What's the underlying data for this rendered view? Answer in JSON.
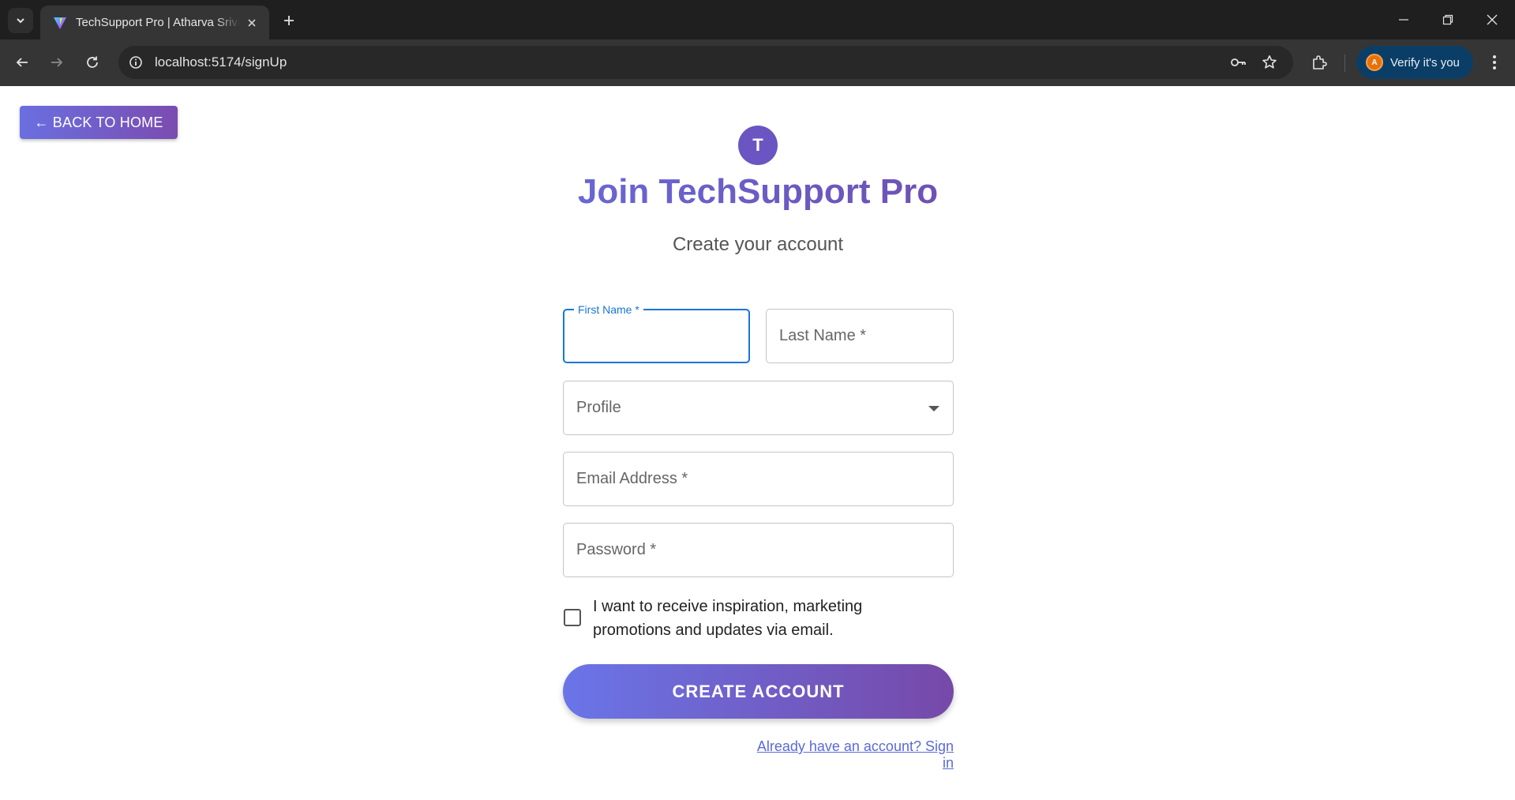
{
  "browser": {
    "tab_title": "TechSupport Pro | Atharva Srivastava",
    "url": "localhost:5174/signUp",
    "profile_initial": "A",
    "verify_label": "Verify it's you"
  },
  "page": {
    "back_button": "← BACK TO HOME",
    "logo_letter": "T",
    "title": "Join TechSupport Pro",
    "subtitle": "Create your account",
    "fields": {
      "first_name_label": "First Name *",
      "first_name_value": "",
      "last_name_label": "Last Name *",
      "profile_label": "Profile",
      "email_label": "Email Address *",
      "password_label": "Password *"
    },
    "checkbox_label": "I want to receive inspiration, marketing promotions and updates via email.",
    "create_button": "CREATE ACCOUNT",
    "signin_link": "Already have an account? Sign in"
  },
  "colors": {
    "accent_blue": "#1976d2",
    "gradient_start": "#6a75e8",
    "gradient_end": "#7649a8"
  }
}
